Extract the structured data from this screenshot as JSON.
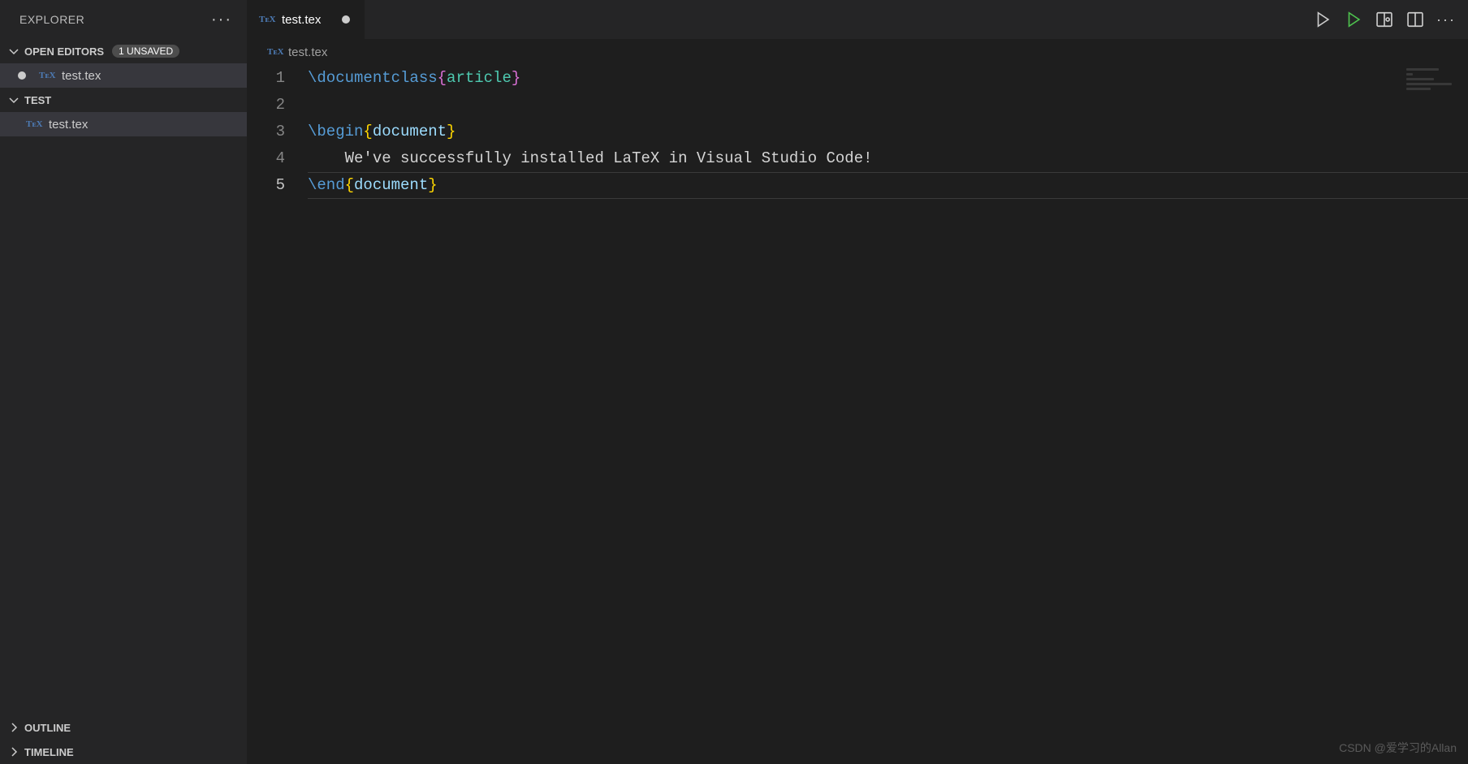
{
  "sidebar": {
    "title": "EXPLORER",
    "sections": {
      "openEditors": {
        "label": "OPEN EDITORS",
        "badge": "1 UNSAVED",
        "items": [
          {
            "name": "test.tex",
            "dirty": true
          }
        ]
      },
      "folder": {
        "label": "TEST",
        "items": [
          {
            "name": "test.tex"
          }
        ]
      },
      "outline": {
        "label": "OUTLINE"
      },
      "timeline": {
        "label": "TIMELINE"
      }
    }
  },
  "tabs": [
    {
      "name": "test.tex",
      "dirty": true
    }
  ],
  "breadcrumb": {
    "file": "test.tex"
  },
  "editor": {
    "lineNumbers": [
      "1",
      "2",
      "3",
      "4",
      "5"
    ],
    "activeLine": 5,
    "code": {
      "line1_cmd": "\\documentclass",
      "line1_arg": "article",
      "line3_cmd": "\\begin",
      "line3_arg": "document",
      "line4_text": "    We've successfully installed LaTeX in Visual Studio Code!",
      "line5_cmd": "\\end",
      "line5_arg": "document"
    }
  },
  "texIconLabel": "TᴇX",
  "watermark": "CSDN @爱学习的Allan"
}
